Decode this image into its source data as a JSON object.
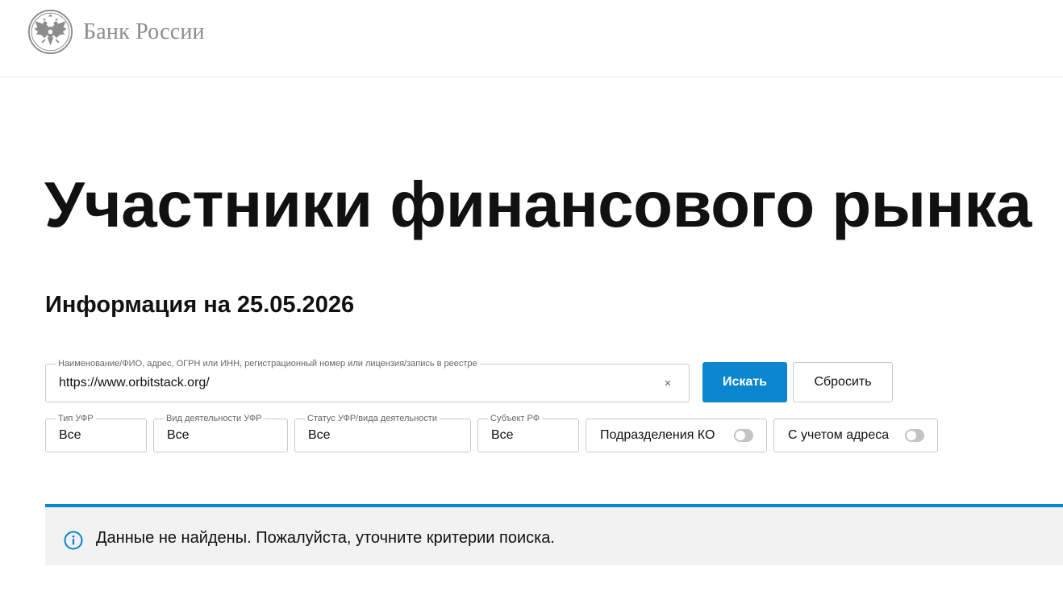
{
  "brand": {
    "name": "Банк России",
    "emblem_icon": "double-headed-eagle-icon"
  },
  "page": {
    "title": "Участники финансового рынка",
    "info_heading": "Информация на 25.05.2026"
  },
  "search": {
    "label": "Наименование/ФИО, адрес, ОГРН или ИНН, регистрационный номер или лицензия/запись в реестре",
    "value": "https://www.orbitstack.org/",
    "clear_icon": "×",
    "submit_label": "Искать",
    "reset_label": "Сбросить"
  },
  "filters": {
    "ufr_type": {
      "label": "Тип УФР",
      "value": "Все"
    },
    "activity_type": {
      "label": "Вид деятельности УФР",
      "value": "Все"
    },
    "status": {
      "label": "Статус УФР/вида деятельности",
      "value": "Все"
    },
    "region": {
      "label": "Субъект РФ",
      "value": "Все"
    },
    "branches_toggle": {
      "label": "Подразделения КО",
      "on": false
    },
    "address_toggle": {
      "label": "С учетом адреса",
      "on": false
    }
  },
  "notice": {
    "icon": "info-icon",
    "text": "Данные не найдены. Пожалуйста, уточните критерии поиска."
  },
  "colors": {
    "accent": "#0a86cf",
    "logo_text": "#8c8c8c",
    "notice_bg": "#f2f2f2",
    "border": "#c9c9c9"
  }
}
